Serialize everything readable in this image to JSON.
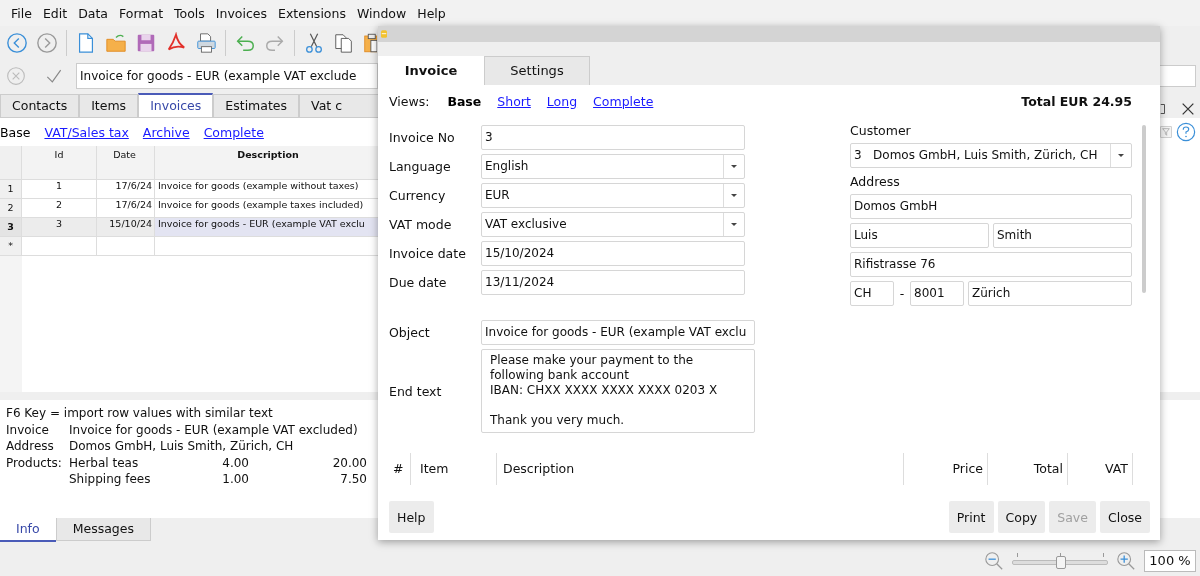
{
  "menu": [
    "File",
    "Edit",
    "Data",
    "Format",
    "Tools",
    "Invoices",
    "Extensions",
    "Window",
    "Help"
  ],
  "formula_bar": {
    "value": "Invoice for goods - EUR (example VAT exclude"
  },
  "tabs": [
    {
      "label": "Contacts",
      "selected": false
    },
    {
      "label": "Items",
      "selected": false
    },
    {
      "label": "Invoices",
      "selected": true
    },
    {
      "label": "Estimates",
      "selected": false
    },
    {
      "label": "Vat c",
      "selected": false
    }
  ],
  "views": [
    {
      "label": "Base",
      "selected": true
    },
    {
      "label": "VAT/Sales tax",
      "selected": false
    },
    {
      "label": "Archive",
      "selected": false
    },
    {
      "label": "Complete",
      "selected": false
    }
  ],
  "table": {
    "columns": [
      "Id",
      "Date",
      "Description"
    ],
    "rows": [
      {
        "number": "1",
        "id": "1",
        "date": "17/6/24",
        "description": "Invoice for goods (example without taxes)",
        "selected": false
      },
      {
        "number": "2",
        "id": "2",
        "date": "17/6/24",
        "description": "Invoice for goods (example taxes included)",
        "selected": false
      },
      {
        "number": "3",
        "id": "3",
        "date": "15/10/24",
        "description": "Invoice for goods - EUR (example VAT exclu",
        "selected": true
      }
    ],
    "new_row_marker": "*"
  },
  "info": {
    "hint": "F6 Key = import row values with similar text",
    "lines": [
      {
        "label": "Invoice",
        "value": "Invoice for goods - EUR (example VAT excluded)"
      },
      {
        "label": "Address",
        "value": "Domos GmbH, Luis Smith, Zürich, CH"
      }
    ],
    "products_label": "Products:",
    "products": [
      {
        "name": "Herbal teas",
        "quantity": "4.00",
        "amount": "20.00"
      },
      {
        "name": "Shipping fees",
        "quantity": "1.00",
        "amount": "7.50"
      }
    ]
  },
  "bottom_tabs": [
    {
      "label": "Info",
      "selected": true
    },
    {
      "label": "Messages",
      "selected": false
    }
  ],
  "zoom": {
    "level": 0.5,
    "value": "100 %"
  },
  "dialog": {
    "tabs": [
      {
        "label": "Invoice",
        "selected": true
      },
      {
        "label": "Settings",
        "selected": false
      }
    ],
    "views_label": "Views:",
    "views": [
      {
        "label": "Base",
        "selected": true
      },
      {
        "label": "Short",
        "selected": false
      },
      {
        "label": "Long",
        "selected": false
      },
      {
        "label": "Complete",
        "selected": false
      }
    ],
    "total": "Total EUR 24.95",
    "fields": [
      {
        "label": "Invoice No",
        "value": "3",
        "kind": "text"
      },
      {
        "label": "Language",
        "value": "English",
        "kind": "select"
      },
      {
        "label": "Currency",
        "value": "EUR",
        "kind": "select"
      },
      {
        "label": "VAT mode",
        "value": "VAT exclusive",
        "kind": "select"
      },
      {
        "label": "Invoice date",
        "value": "15/10/2024",
        "kind": "text"
      },
      {
        "label": "Due date",
        "value": "13/11/2024",
        "kind": "text"
      }
    ],
    "object": {
      "label": "Object",
      "value": "Invoice for goods - EUR (example VAT exclu"
    },
    "end_text": {
      "label": "End text",
      "value": "Please make your payment to the\nfollowing bank account\nIBAN: CHXX XXXX XXXX XXXX 0203 X\n\nThank you very much."
    },
    "customer": {
      "label": "Customer",
      "number": "3",
      "name": "Domos GmbH, Luis Smith, Zürich, CH"
    },
    "address": {
      "label": "Address",
      "company": "Domos GmbH",
      "first_name": "Luis",
      "last_name": "Smith",
      "street": "Rifistrasse 76",
      "country": "CH",
      "separator": "-",
      "postal_code": "8001",
      "city": "Zürich"
    },
    "items_columns": [
      "#",
      "Item",
      "Description",
      "Price",
      "Total",
      "VAT"
    ],
    "help_button": "Help",
    "buttons": [
      {
        "label": "Print",
        "disabled": false
      },
      {
        "label": "Copy",
        "disabled": false
      },
      {
        "label": "Save",
        "disabled": true
      },
      {
        "label": "Close",
        "disabled": false
      }
    ]
  }
}
